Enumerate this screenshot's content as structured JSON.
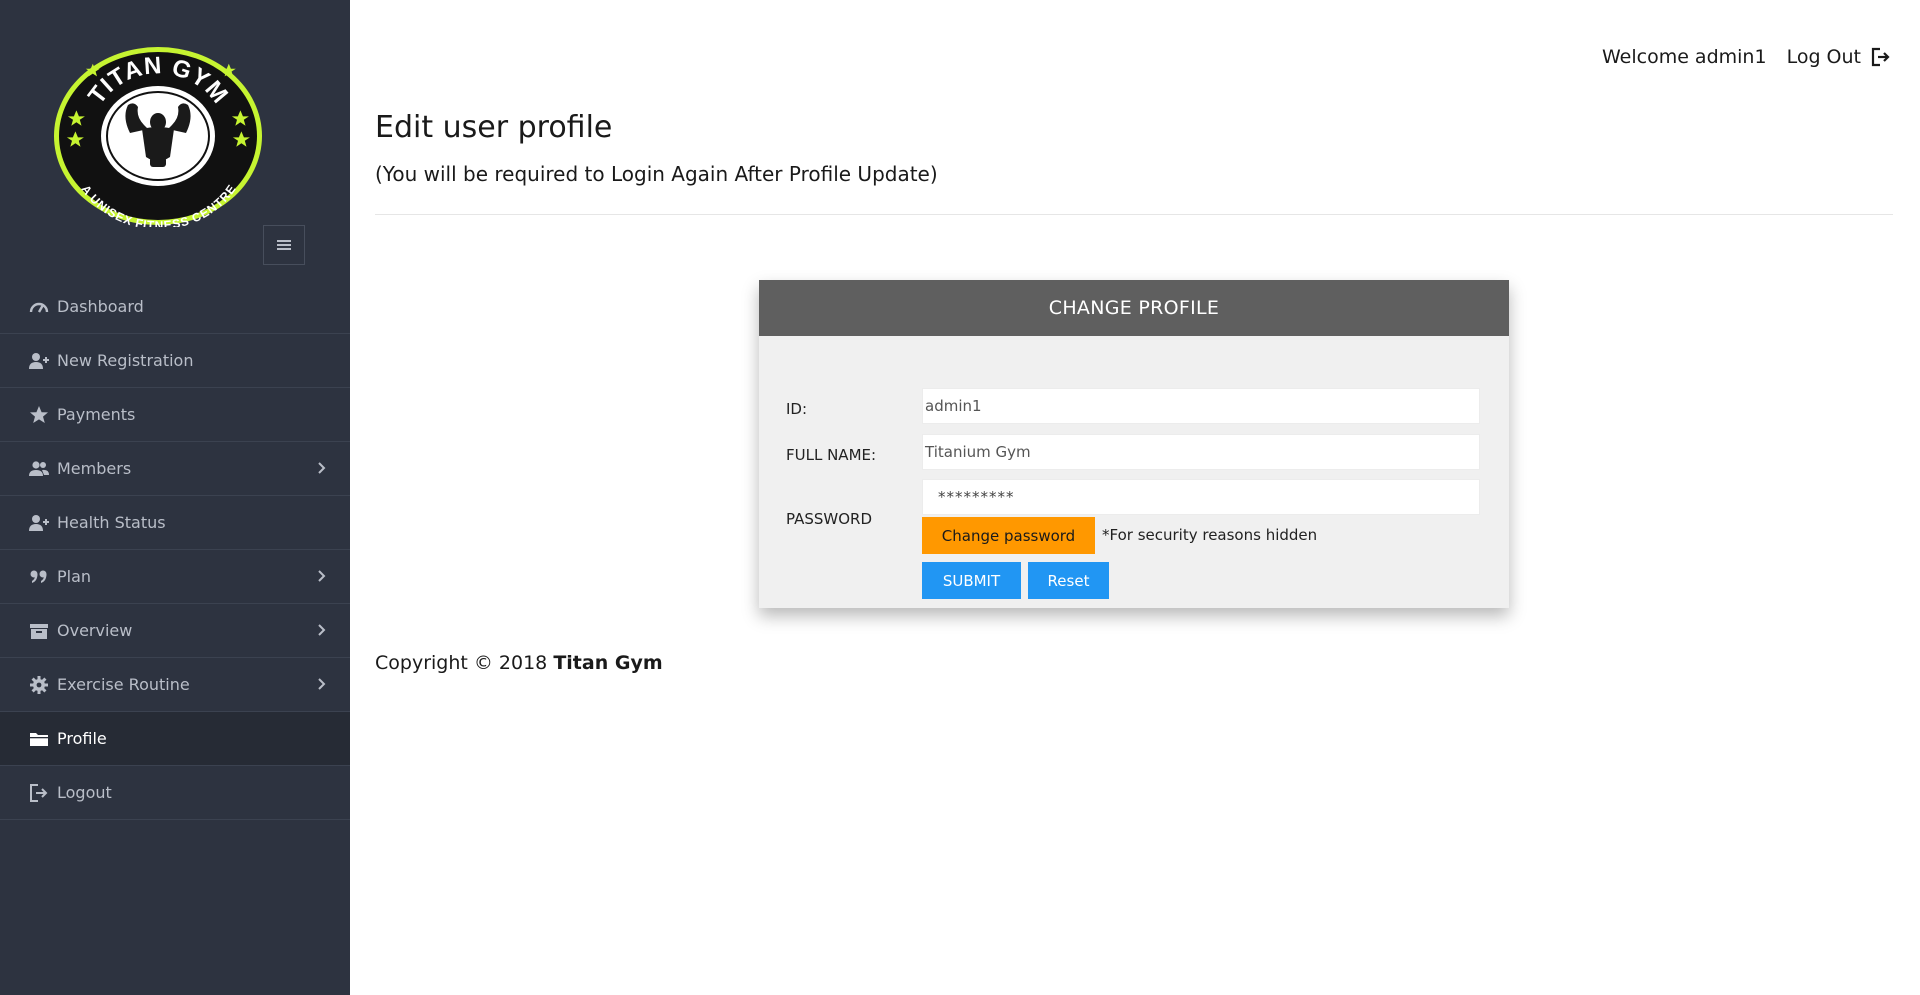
{
  "header": {
    "welcome_text": "Welcome admin1",
    "logout_label": "Log Out"
  },
  "logo": {
    "top_text": "TITAN GYM",
    "bottom_text": "A UNISEX FITNESS CENTRE"
  },
  "sidebar": {
    "items": [
      {
        "label": "Dashboard",
        "icon": "dashboard-gauge-icon",
        "has_submenu": false,
        "active": false
      },
      {
        "label": "New Registration",
        "icon": "user-plus-icon",
        "has_submenu": false,
        "active": false
      },
      {
        "label": "Payments",
        "icon": "star-icon",
        "has_submenu": false,
        "active": false
      },
      {
        "label": "Members",
        "icon": "users-icon",
        "has_submenu": true,
        "active": false
      },
      {
        "label": "Health Status",
        "icon": "user-plus-icon",
        "has_submenu": false,
        "active": false
      },
      {
        "label": "Plan",
        "icon": "quote-icon",
        "has_submenu": true,
        "active": false
      },
      {
        "label": "Overview",
        "icon": "archive-icon",
        "has_submenu": true,
        "active": false
      },
      {
        "label": "Exercise Routine",
        "icon": "gear-icon",
        "has_submenu": true,
        "active": false
      },
      {
        "label": "Profile",
        "icon": "folder-icon",
        "has_submenu": false,
        "active": true
      },
      {
        "label": "Logout",
        "icon": "sign-out-icon",
        "has_submenu": false,
        "active": false
      }
    ]
  },
  "page": {
    "title": "Edit user profile",
    "subtitle": "(You will be required to Login Again After Profile Update)"
  },
  "form": {
    "header": "CHANGE PROFILE",
    "id_label": "ID:",
    "id_value": "admin1",
    "fullname_label": "FULL NAME:",
    "fullname_value": "Titanium Gym",
    "password_label": "PASSWORD",
    "password_value": "*********",
    "change_password_label": "Change password",
    "security_note": "*For security reasons hidden",
    "submit_label": "SUBMIT",
    "reset_label": "Reset"
  },
  "footer": {
    "copyright_prefix": "Copyright © 2018",
    "brand": "Titan Gym"
  },
  "colors": {
    "sidebar_bg": "#2d3340",
    "card_header_bg": "#5f5f5f",
    "primary_button": "#2196f3",
    "warning_button": "#ff9800",
    "logo_accent": "#c6f431"
  }
}
